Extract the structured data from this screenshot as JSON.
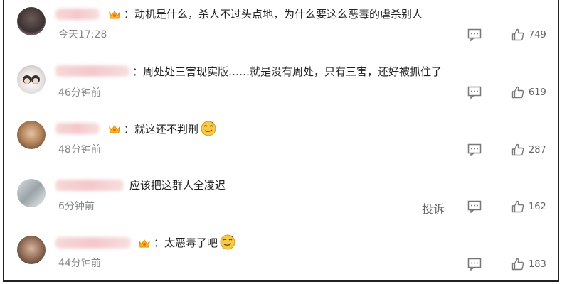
{
  "comments": [
    {
      "name_tail": "",
      "has_crown": true,
      "text": "动机是什么，杀人不过头点地，为什么要这么恶毒的虐杀别人",
      "has_emoji": false,
      "time": "今天17:28",
      "likes": "749",
      "show_report": false
    },
    {
      "name_tail": "",
      "has_crown": false,
      "text": "周处处三害现实版……就是没有周处，只有三害，还好被抓住了",
      "has_emoji": false,
      "time": "46分钟前",
      "likes": "619",
      "show_report": false
    },
    {
      "name_tail": "",
      "has_crown": true,
      "text": "就这还不判刑",
      "has_emoji": true,
      "time": "48分钟前",
      "likes": "287",
      "show_report": false
    },
    {
      "name_tail": "",
      "has_crown": false,
      "text": "应该把这群人全凌迟",
      "has_emoji": false,
      "time": "6分钟前",
      "likes": "162",
      "show_report": true
    },
    {
      "name_tail": "",
      "has_crown": true,
      "text": "太恶毒了吧",
      "has_emoji": true,
      "time": "44分钟前",
      "likes": "183",
      "show_report": false
    }
  ],
  "labels": {
    "report": "投诉",
    "colon": "："
  },
  "icons": {
    "reply": "comment-reply-icon",
    "like": "thumbs-up-icon",
    "crown": "crown-badge-icon",
    "emoji": "smirk-emoji-icon"
  }
}
